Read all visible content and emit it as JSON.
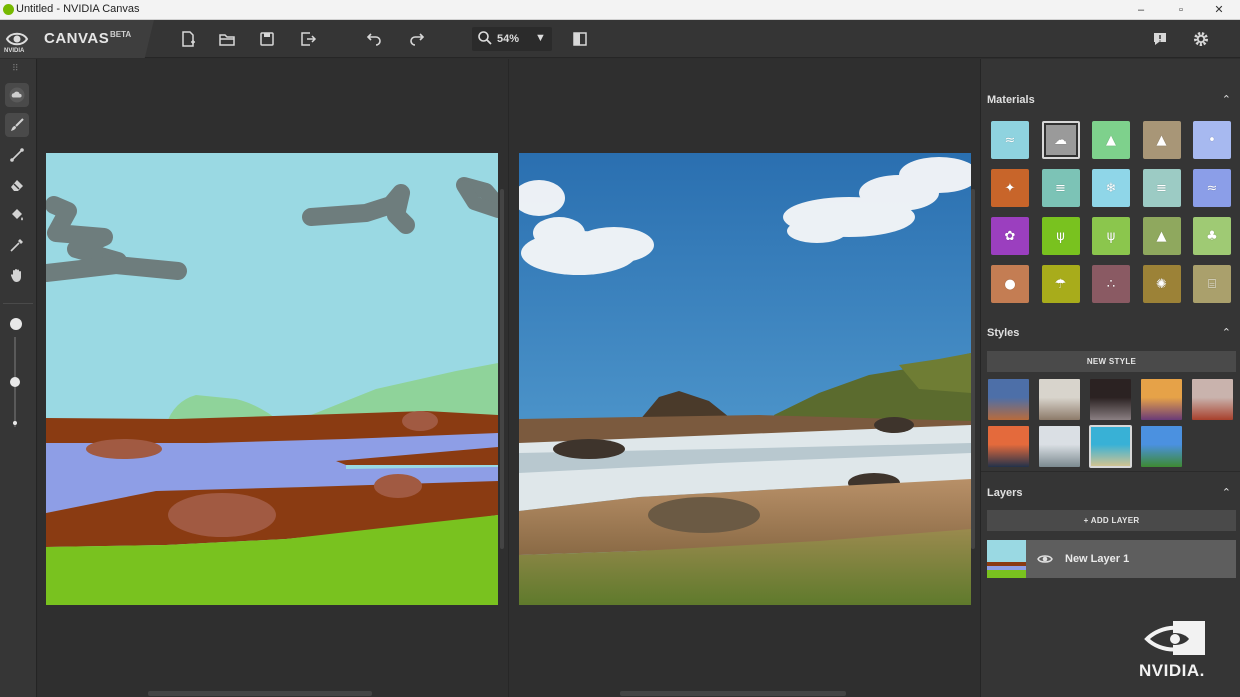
{
  "window": {
    "title": "Untitled - NVIDIA Canvas",
    "minimize_glyph": "–",
    "maximize_glyph": "▫",
    "close_glyph": "✕"
  },
  "brand": {
    "logo_text": "NVIDIA",
    "app_name": "CANVAS",
    "badge": "BETA"
  },
  "toolbar": {
    "zoom_value": "54%",
    "zoom_caret": "▼",
    "icons": [
      "new-file-icon",
      "open-folder-icon",
      "save-icon",
      "export-icon",
      "undo-icon",
      "redo-icon",
      "zoom-icon",
      "split-view-icon",
      "feedback-icon",
      "settings-icon"
    ]
  },
  "tools": [
    "material-picker-icon",
    "brush-icon",
    "line-icon",
    "eraser-icon",
    "fill-bucket-icon",
    "eyedropper-icon",
    "pan-hand-icon"
  ],
  "panel": {
    "materials": {
      "title": "Materials",
      "chevron": "⌃",
      "swatches": [
        {
          "name": "material-sea",
          "color": "#8fd3df",
          "glyph": "≈"
        },
        {
          "name": "material-cloud",
          "color": "#9a9a9a",
          "glyph": "☁"
        },
        {
          "name": "material-hill",
          "color": "#7ed18c",
          "glyph": "▲"
        },
        {
          "name": "material-mountain",
          "color": "#a89677",
          "glyph": "▲"
        },
        {
          "name": "material-sky",
          "color": "#a7b9f0",
          "glyph": "•"
        },
        {
          "name": "material-dirt",
          "color": "#c8652a",
          "glyph": "✦"
        },
        {
          "name": "material-fog",
          "color": "#7cc3b6",
          "glyph": "≡"
        },
        {
          "name": "material-snow",
          "color": "#8fd6e8",
          "glyph": "❄"
        },
        {
          "name": "material-river",
          "color": "#9ccbc4",
          "glyph": "≡"
        },
        {
          "name": "material-water",
          "color": "#8b9ee8",
          "glyph": "≈"
        },
        {
          "name": "material-flower",
          "color": "#9b3fbf",
          "glyph": "✿"
        },
        {
          "name": "material-grass",
          "color": "#79c21f",
          "glyph": "ψ"
        },
        {
          "name": "material-plant",
          "color": "#8bc64d",
          "glyph": "ψ"
        },
        {
          "name": "material-bush",
          "color": "#8fa85e",
          "glyph": "▲"
        },
        {
          "name": "material-tree",
          "color": "#9fca74",
          "glyph": "♣"
        },
        {
          "name": "material-rock",
          "color": "#c47d53",
          "glyph": "●"
        },
        {
          "name": "material-beach",
          "color": "#a8ac1b",
          "glyph": "☂"
        },
        {
          "name": "material-gravel",
          "color": "#8a5a63",
          "glyph": "∴"
        },
        {
          "name": "material-sand",
          "color": "#9c8237",
          "glyph": "✺"
        },
        {
          "name": "material-stone",
          "color": "#aaa06c",
          "glyph": "⌸"
        }
      ]
    },
    "styles": {
      "title": "Styles",
      "chevron": "⌃",
      "new_style_label": "NEW STYLE",
      "thumbs": [
        {
          "name": "style-thumb-1",
          "c1": "#4d6fa8",
          "c2": "#b86b3c"
        },
        {
          "name": "style-thumb-2",
          "c1": "#d8d4cc",
          "c2": "#8d7b6a"
        },
        {
          "name": "style-thumb-3",
          "c1": "#2b2222",
          "c2": "#8a7f82"
        },
        {
          "name": "style-thumb-4",
          "c1": "#e6a248",
          "c2": "#6a3b78"
        },
        {
          "name": "style-thumb-5",
          "c1": "#c9b3ad",
          "c2": "#a8402c"
        },
        {
          "name": "style-thumb-6",
          "c1": "#e46a3c",
          "c2": "#23324a"
        },
        {
          "name": "style-thumb-7",
          "c1": "#dadfe4",
          "c2": "#7c8a90"
        },
        {
          "name": "style-thumb-8",
          "c1": "#38b1d6",
          "c2": "#d8c48e"
        },
        {
          "name": "style-thumb-9",
          "c1": "#4b91e0",
          "c2": "#3e8a32"
        }
      ]
    },
    "layers": {
      "title": "Layers",
      "chevron": "⌃",
      "add_layer_label": "+ ADD LAYER",
      "items": [
        {
          "name": "New Layer 1"
        }
      ]
    },
    "watermark": "NVIDIA."
  },
  "colors": {
    "nvidia_green": "#76b900",
    "sky_paint": "#9ad9e3",
    "water_paint": "#8e9ee6",
    "dirt_paint": "#8a3b12",
    "grass_paint": "#79c21f",
    "cloud_paint": "#6e7d7d",
    "hill_paint": "#8fd39a"
  }
}
